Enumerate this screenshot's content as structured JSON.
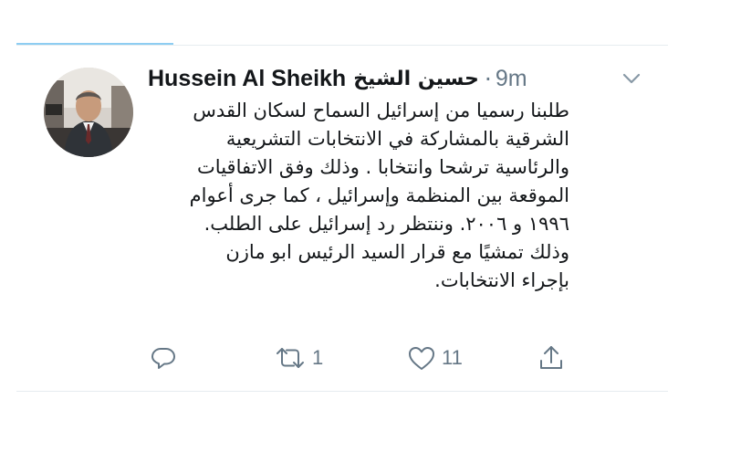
{
  "tweet": {
    "author_name_en": "Hussein Al Sheikh",
    "author_name_ar": "حسين الشيخ",
    "separator": "·",
    "time": "9m",
    "lines": [
      "طلبنا رسميا من إسرائيل السماح لسكان القدس",
      "الشرقية بالمشاركة في الانتخابات التشريعية",
      "والرئاسية ترشحا وانتخابا . وذلك وفق الاتفاقيات",
      "الموقعة بين المنظمة وإسرائيل ، كما جرى أعوام",
      "١٩٩٦ و ٢٠٠٦. وننتظر رد إسرائيل على الطلب.",
      "وذلك تمشيًا مع قرار السيد الرئيس ابو مازن",
      "بإجراء الانتخابات."
    ]
  },
  "actions": {
    "reply_icon": "reply-icon",
    "retweet_icon": "retweet-icon",
    "retweet_count": "1",
    "like_icon": "heart-icon",
    "like_count": "11",
    "share_icon": "share-icon"
  },
  "colors": {
    "text": "#14171a",
    "secondary": "#657786",
    "divider": "#e6ecf0",
    "accent_underline": "#8ecdf2"
  }
}
